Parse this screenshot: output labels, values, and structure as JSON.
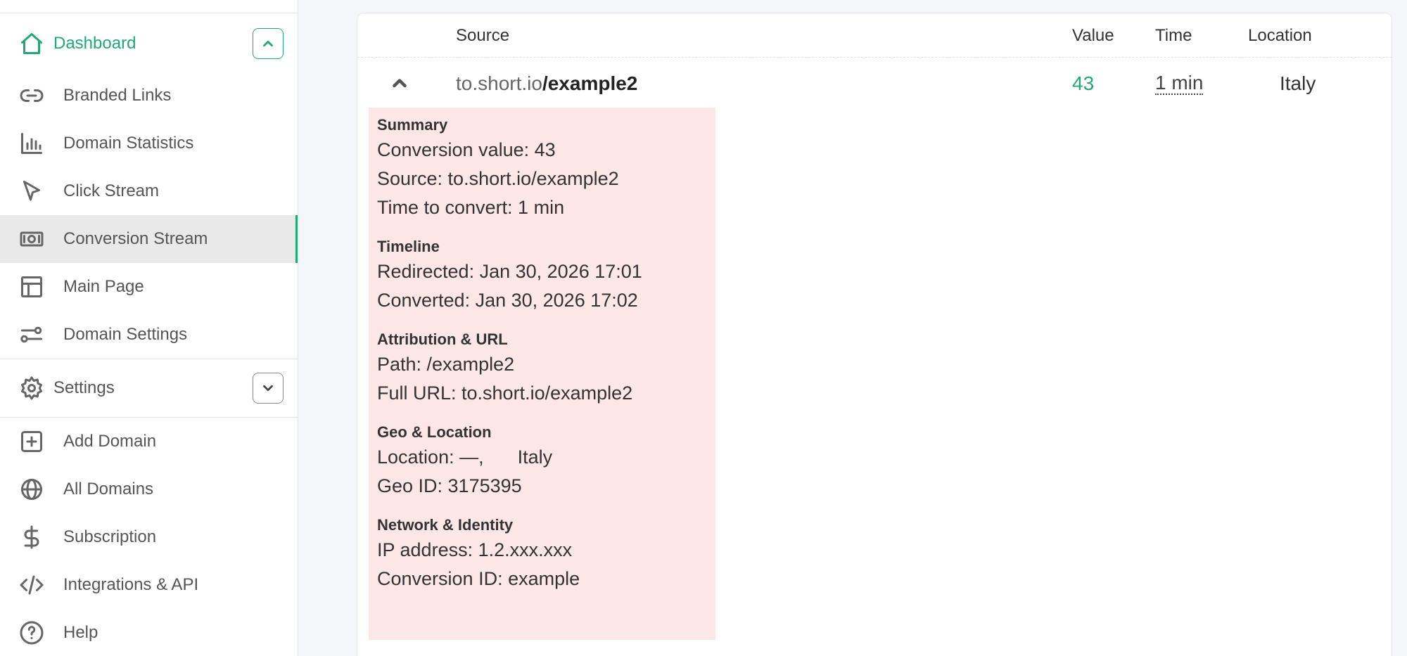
{
  "sidebar": {
    "dashboard": {
      "label": "Dashboard",
      "icon": "home-icon"
    },
    "items": [
      {
        "label": "Branded Links",
        "icon": "link-icon"
      },
      {
        "label": "Domain Statistics",
        "icon": "bar-chart-icon"
      },
      {
        "label": "Click Stream",
        "icon": "cursor-icon"
      },
      {
        "label": "Conversion Stream",
        "icon": "money-icon",
        "active": true
      },
      {
        "label": "Main Page",
        "icon": "layout-icon"
      },
      {
        "label": "Domain Settings",
        "icon": "sliders-icon"
      }
    ],
    "settings": {
      "label": "Settings",
      "icon": "gear-icon"
    },
    "bottom_items": [
      {
        "label": "Add Domain",
        "icon": "plus-square-icon"
      },
      {
        "label": "All Domains",
        "icon": "globe-icon"
      },
      {
        "label": "Subscription",
        "icon": "dollar-icon"
      },
      {
        "label": "Integrations & API",
        "icon": "code-icon"
      },
      {
        "label": "Help",
        "icon": "help-circle-icon"
      }
    ]
  },
  "table": {
    "headers": {
      "source": "Source",
      "value": "Value",
      "time": "Time",
      "location": "Location"
    },
    "row": {
      "source_domain": "to.short.io",
      "source_path": "/example2",
      "value": "43",
      "time": "1 min",
      "location": "Italy"
    }
  },
  "details": {
    "summary": {
      "title": "Summary",
      "conversion_value": "Conversion value: 43",
      "source": "Source: to.short.io/example2",
      "time_to_convert": "Time to convert: 1 min"
    },
    "timeline": {
      "title": "Timeline",
      "redirected": "Redirected: Jan 30, 2026 17:01",
      "converted": "Converted: Jan 30, 2026 17:02"
    },
    "attribution": {
      "title": "Attribution & URL",
      "path": "Path: /example2",
      "full_url": "Full URL: to.short.io/example2"
    },
    "geo": {
      "title": "Geo & Location",
      "location_prefix": "Location: —,",
      "location_country": "Italy",
      "geo_id": "Geo ID: 3175395"
    },
    "network": {
      "title": "Network & Identity",
      "ip": "IP address: 1.2.xxx.xxx",
      "conversion_id": "Conversion ID: example"
    }
  },
  "colors": {
    "accent": "#23a875",
    "details_bg": "#fde6e6",
    "active_bg": "#e9e9e9"
  }
}
